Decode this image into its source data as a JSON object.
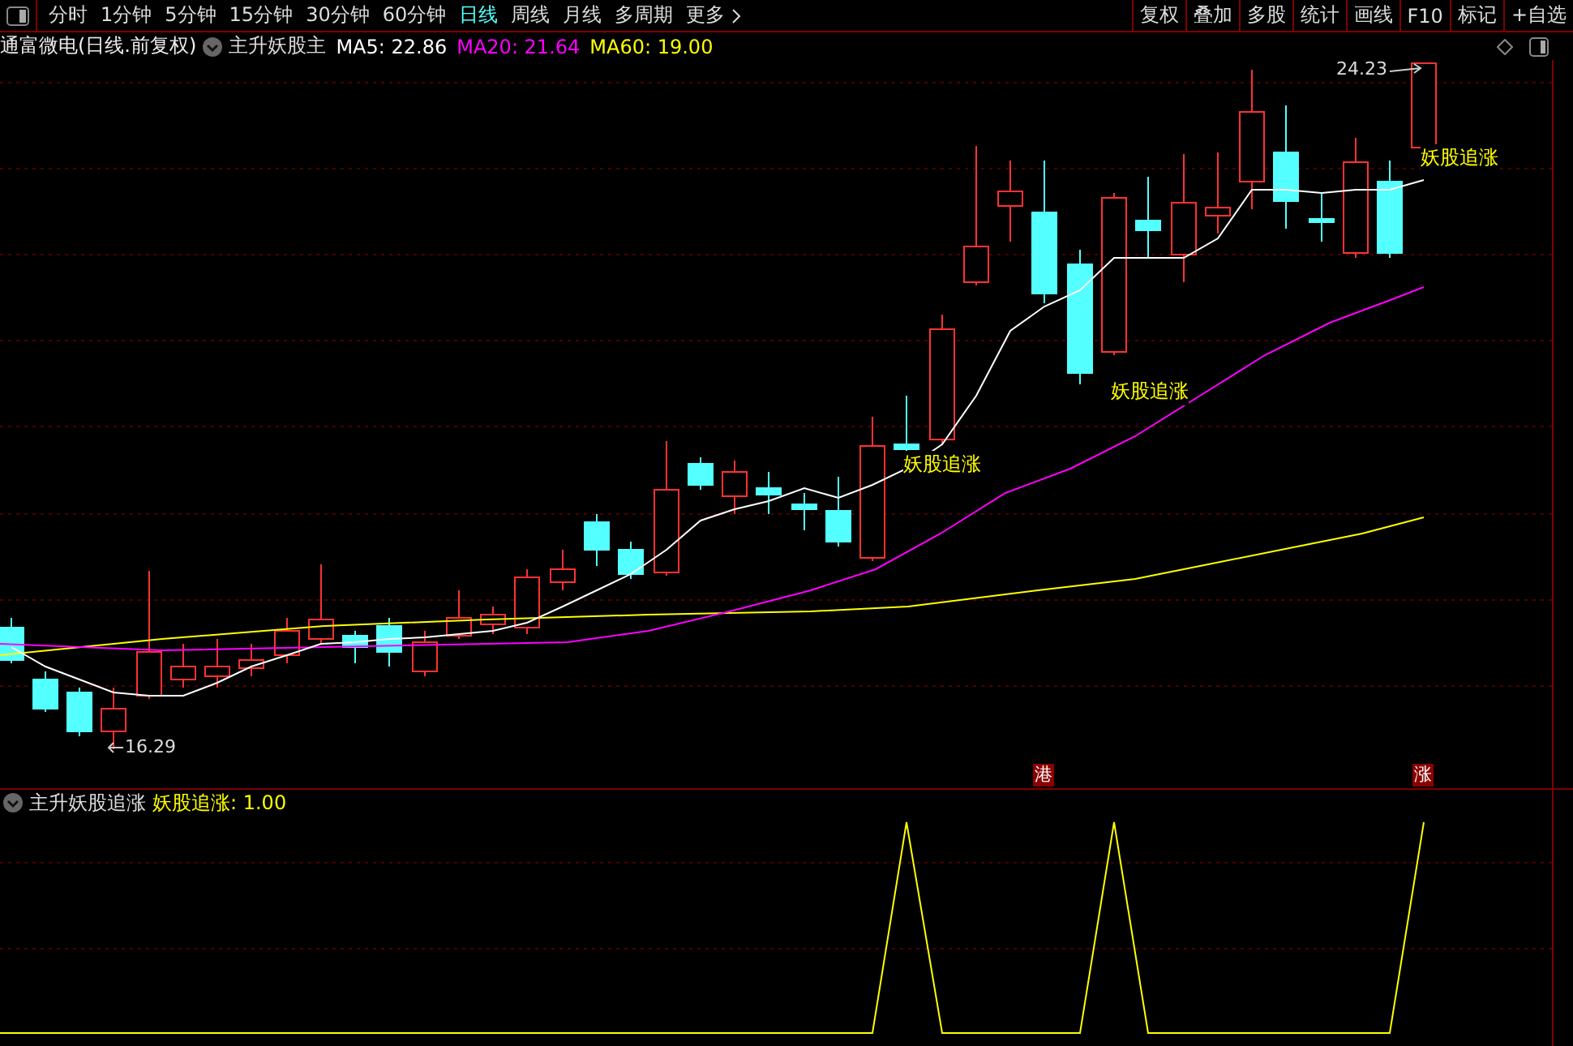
{
  "toolbar": {
    "periods": [
      {
        "label": "分时",
        "selected": false
      },
      {
        "label": "1分钟",
        "selected": false
      },
      {
        "label": "5分钟",
        "selected": false
      },
      {
        "label": "15分钟",
        "selected": false
      },
      {
        "label": "30分钟",
        "selected": false
      },
      {
        "label": "60分钟",
        "selected": false
      },
      {
        "label": "日线",
        "selected": true
      },
      {
        "label": "周线",
        "selected": false
      },
      {
        "label": "月线",
        "selected": false
      },
      {
        "label": "多周期",
        "selected": false
      },
      {
        "label": "更多",
        "selected": false
      }
    ],
    "actions": [
      "复权",
      "叠加",
      "多股",
      "统计",
      "画线",
      "F10",
      "标记",
      "+自选"
    ]
  },
  "info": {
    "stock": "通富微电(日线.前复权)",
    "indicator": "主升妖股主",
    "averages": [
      {
        "label": "MA5: 22.86",
        "color": "#ffffff"
      },
      {
        "label": "MA20: 21.64",
        "color": "#ff00ff"
      },
      {
        "label": "MA60: 19.00",
        "color": "#ffff00"
      }
    ]
  },
  "main_chart": {
    "annotations": [
      {
        "kind": "low",
        "text": "16.29"
      },
      {
        "kind": "high",
        "text": "24.23"
      },
      {
        "kind": "signal",
        "text": "妖股追涨"
      },
      {
        "kind": "signal",
        "text": "妖股追涨"
      },
      {
        "kind": "signal",
        "text": "妖股追涨"
      }
    ],
    "badges": [
      "港",
      "涨"
    ]
  },
  "sub_pane": {
    "title": "主升妖股追涨",
    "reading": "妖股追涨: 1.00"
  }
}
